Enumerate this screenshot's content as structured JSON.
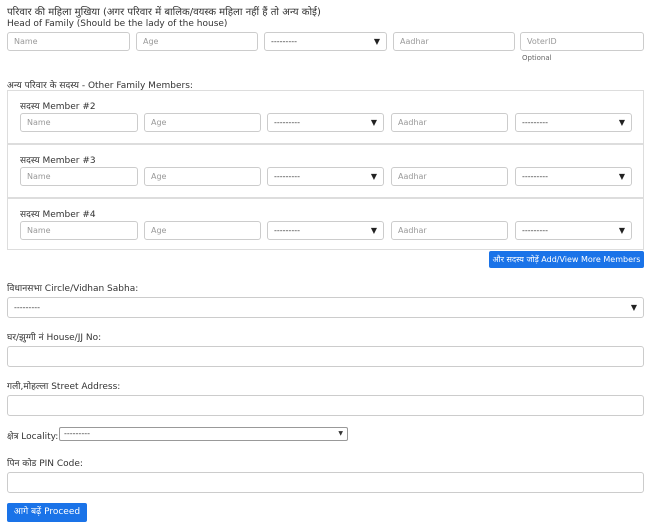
{
  "head": {
    "title": "परिवार की महिला मुखिया (अगर परिवार में बालिक/वयस्क महिला नहीं हैं तो अन्य कोई)",
    "subtitle": "Head of Family (Should be the lady of the house)",
    "name_placeholder": "Name",
    "age_placeholder": "Age",
    "gender_value": "---------",
    "aadhar_placeholder": "Aadhar",
    "voter_placeholder": "VoterID",
    "voter_note": "Optional"
  },
  "members": {
    "heading": "अन्य परिवार के सदस्य - Other Family Members:",
    "items": [
      {
        "label": "सदस्य Member #2",
        "name": "Name",
        "age": "Age",
        "gender": "---------",
        "aadhar": "Aadhar",
        "relation": "---------"
      },
      {
        "label": "सदस्य Member #3",
        "name": "Name",
        "age": "Age",
        "gender": "---------",
        "aadhar": "Aadhar",
        "relation": "---------"
      },
      {
        "label": "सदस्य Member #4",
        "name": "Name",
        "age": "Age",
        "gender": "---------",
        "aadhar": "Aadhar",
        "relation": "---------"
      }
    ],
    "add_button": "और सदस्य जोड़ें Add/View More Members"
  },
  "address": {
    "circle_label": "विधानसभा Circle/Vidhan Sabha:",
    "circle_value": "---------",
    "house_label": "घर/झुग्गी नं House/JJ No:",
    "street_label": "गली,मोहल्ला Street Address:",
    "locality_label": "क्षेत्र Locality:",
    "locality_value": "---------",
    "pin_label": "पिन कोड PIN Code:"
  },
  "proceed_button": "आगे बढ़ें Proceed",
  "icons": {
    "caret": "▼"
  },
  "colors": {
    "accent": "#1a73e8",
    "border": "#cccccc"
  }
}
